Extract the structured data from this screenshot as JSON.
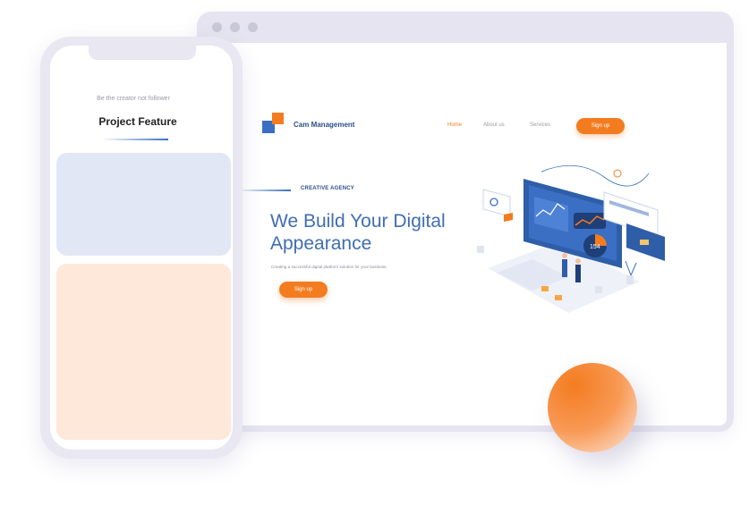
{
  "browser": {
    "brand": "Cam Management",
    "nav": {
      "home": "Home",
      "about": "About us",
      "services": "Services",
      "signup": "Sign up"
    },
    "hero": {
      "eyebrow": "CREATIVE AGENCY",
      "headline": "We Build Your Digital Appearance",
      "subtitle": "Creating a successful digital platform solution for your business.",
      "cta": "Sign up"
    },
    "illustration_badge": "154"
  },
  "phone": {
    "tagline": "Be the creator not follower",
    "title": "Project Feature"
  },
  "colors": {
    "accent": "#f47c20",
    "brand_blue": "#3a6fc4",
    "dark_blue": "#2c4e86",
    "card_blue": "#e1e7f5",
    "card_peach": "#fde8da",
    "frame": "#e5e4f0"
  }
}
